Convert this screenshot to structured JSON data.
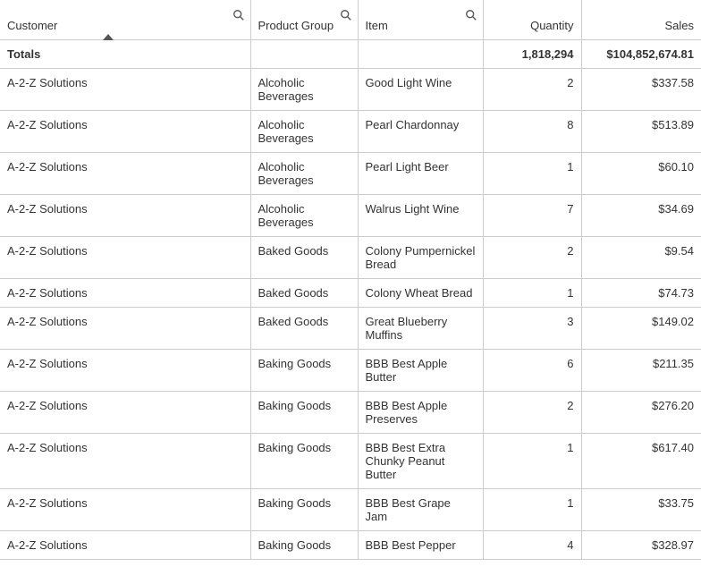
{
  "columns": {
    "customer": "Customer",
    "product_group": "Product Group",
    "item": "Item",
    "quantity": "Quantity",
    "sales": "Sales"
  },
  "totals": {
    "label": "Totals",
    "quantity": "1,818,294",
    "sales": "$104,852,674.81"
  },
  "rows": [
    {
      "customer": "A-2-Z Solutions",
      "product_group": "Alcoholic Beverages",
      "item": "Good Light Wine",
      "quantity": "2",
      "sales": "$337.58"
    },
    {
      "customer": "A-2-Z Solutions",
      "product_group": "Alcoholic Beverages",
      "item": "Pearl Chardonnay",
      "quantity": "8",
      "sales": "$513.89"
    },
    {
      "customer": "A-2-Z Solutions",
      "product_group": "Alcoholic Beverages",
      "item": "Pearl Light Beer",
      "quantity": "1",
      "sales": "$60.10"
    },
    {
      "customer": "A-2-Z Solutions",
      "product_group": "Alcoholic Beverages",
      "item": "Walrus Light Wine",
      "quantity": "7",
      "sales": "$34.69"
    },
    {
      "customer": "A-2-Z Solutions",
      "product_group": "Baked Goods",
      "item": "Colony Pumpernickel Bread",
      "quantity": "2",
      "sales": "$9.54"
    },
    {
      "customer": "A-2-Z Solutions",
      "product_group": "Baked Goods",
      "item": "Colony Wheat Bread",
      "quantity": "1",
      "sales": "$74.73"
    },
    {
      "customer": "A-2-Z Solutions",
      "product_group": "Baked Goods",
      "item": "Great Blueberry Muffins",
      "quantity": "3",
      "sales": "$149.02"
    },
    {
      "customer": "A-2-Z Solutions",
      "product_group": "Baking Goods",
      "item": "BBB Best Apple Butter",
      "quantity": "6",
      "sales": "$211.35"
    },
    {
      "customer": "A-2-Z Solutions",
      "product_group": "Baking Goods",
      "item": "BBB Best Apple Preserves",
      "quantity": "2",
      "sales": "$276.20"
    },
    {
      "customer": "A-2-Z Solutions",
      "product_group": "Baking Goods",
      "item": "BBB Best Extra Chunky Peanut Butter",
      "quantity": "1",
      "sales": "$617.40"
    },
    {
      "customer": "A-2-Z Solutions",
      "product_group": "Baking Goods",
      "item": "BBB Best Grape Jam",
      "quantity": "1",
      "sales": "$33.75"
    },
    {
      "customer": "A-2-Z Solutions",
      "product_group": "Baking Goods",
      "item": "BBB Best Pepper",
      "quantity": "4",
      "sales": "$328.97"
    }
  ]
}
